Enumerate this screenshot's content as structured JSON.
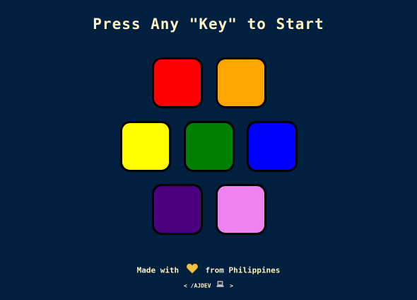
{
  "header": {
    "title": "Press Any \"Key\" to Start"
  },
  "game": {
    "buttons": [
      {
        "id": "red",
        "color": "#ff0000"
      },
      {
        "id": "orange",
        "color": "#ffa500"
      },
      {
        "id": "yellow",
        "color": "#ffff00"
      },
      {
        "id": "green",
        "color": "#008000"
      },
      {
        "id": "blue",
        "color": "#0000ff"
      },
      {
        "id": "purple",
        "color": "#4b0082"
      },
      {
        "id": "pink",
        "color": "#ee82ee"
      }
    ]
  },
  "footer": {
    "made_with": "Made with",
    "from": "from Philippines",
    "heart_icon": "yellow-heart-icon",
    "credit_left": "< /AJDEV",
    "credit_right": ">",
    "laptop_icon": "laptop-icon"
  },
  "colors": {
    "background": "#011f3f",
    "text": "#fef2bf",
    "heart": "#f5c342"
  }
}
